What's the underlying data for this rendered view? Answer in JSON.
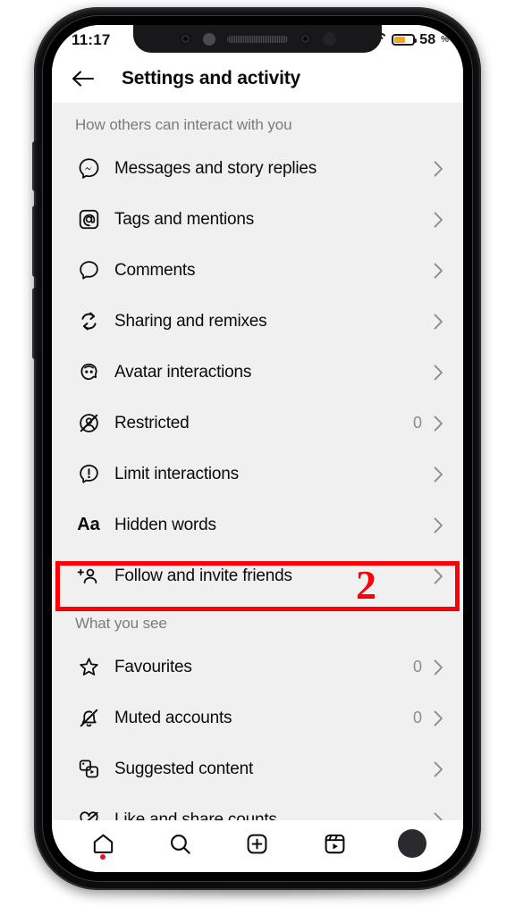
{
  "status_bar": {
    "time": "11:17",
    "battery_percent": "58",
    "battery_percent_sign": "%",
    "battery_level_pct": 58,
    "wifi_icon": "wifi-icon",
    "battery_icon": "battery-icon"
  },
  "header": {
    "back_icon": "back-arrow-icon",
    "title": "Settings and activity"
  },
  "sections": [
    {
      "title": "How others can interact with you",
      "rows": [
        {
          "icon": "messenger-icon",
          "label": "Messages and story replies",
          "count": ""
        },
        {
          "icon": "at-mention-icon",
          "label": "Tags and mentions",
          "count": ""
        },
        {
          "icon": "comment-bubble-icon",
          "label": "Comments",
          "count": ""
        },
        {
          "icon": "remix-arrows-icon",
          "label": "Sharing and remixes",
          "count": ""
        },
        {
          "icon": "avatar-face-icon",
          "label": "Avatar interactions",
          "count": ""
        },
        {
          "icon": "restricted-person-icon",
          "label": "Restricted",
          "count": "0"
        },
        {
          "icon": "limit-exclamation-icon",
          "label": "Limit interactions",
          "count": ""
        },
        {
          "icon": "hidden-words-aa-icon",
          "label": "Hidden words",
          "count": ""
        },
        {
          "icon": "add-person-icon",
          "label": "Follow and invite friends",
          "count": ""
        }
      ]
    },
    {
      "title": "What you see",
      "rows": [
        {
          "icon": "star-icon",
          "label": "Favourites",
          "count": "0"
        },
        {
          "icon": "muted-bell-icon",
          "label": "Muted accounts",
          "count": "0"
        },
        {
          "icon": "suggested-content-icon",
          "label": "Suggested content",
          "count": ""
        },
        {
          "icon": "like-share-counts-icon",
          "label": "Like and share counts",
          "count": ""
        }
      ]
    }
  ],
  "annotation": {
    "step_number": "2",
    "highlight_color": "#fb0007",
    "target_label": "Follow and invite friends"
  },
  "bottom_nav": [
    {
      "icon": "home-icon",
      "has_badge": true
    },
    {
      "icon": "search-icon",
      "has_badge": false
    },
    {
      "icon": "create-plus-icon",
      "has_badge": false
    },
    {
      "icon": "reels-icon",
      "has_badge": false
    },
    {
      "icon": "profile-avatar-icon",
      "has_badge": false
    }
  ],
  "colors": {
    "screen_bg": "#f0f0f0",
    "surface": "#ffffff",
    "text_primary": "#0b0b0b",
    "text_muted": "#7b7b7f",
    "accent_red": "#fb0007",
    "battery_amber": "#f0a81e"
  }
}
